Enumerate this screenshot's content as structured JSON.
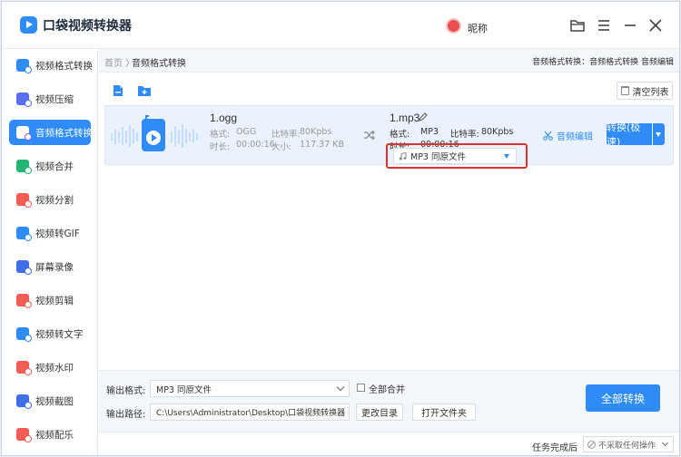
{
  "app": {
    "title": "口袋视频转换器",
    "user_name": "昵称"
  },
  "colors": {
    "accent": "#2f8cf6",
    "highlight": "#e0302e"
  },
  "window_controls": [
    "folder-icon",
    "menu-icon",
    "minimize-icon",
    "close-icon"
  ],
  "sidebar": {
    "items": [
      {
        "label": "视频格式转换",
        "icon": "video-format-icon",
        "color": "#2f8cf6",
        "active": false
      },
      {
        "label": "视频压缩",
        "icon": "video-compress-icon",
        "color": "#5b6ef0",
        "active": false
      },
      {
        "label": "音频格式转换",
        "icon": "audio-format-icon",
        "color": "#8b5cf6",
        "active": true
      },
      {
        "label": "视频合并",
        "icon": "video-merge-icon",
        "color": "#22b573",
        "active": false
      },
      {
        "label": "视频分割",
        "icon": "video-split-icon",
        "color": "#f25c54",
        "active": false
      },
      {
        "label": "视频转GIF",
        "icon": "video-gif-icon",
        "color": "#2f8cf6",
        "active": false
      },
      {
        "label": "屏幕录像",
        "icon": "screen-record-icon",
        "color": "#3f6ee8",
        "active": false
      },
      {
        "label": "视频剪辑",
        "icon": "video-edit-icon",
        "color": "#f25c54",
        "active": false
      },
      {
        "label": "视频转文字",
        "icon": "video-text-icon",
        "color": "#2f8cf6",
        "active": false
      },
      {
        "label": "视频水印",
        "icon": "video-watermark-icon",
        "color": "#f25c54",
        "active": false
      },
      {
        "label": "视频截图",
        "icon": "video-screenshot-icon",
        "color": "#3f6ee8",
        "active": false
      },
      {
        "label": "视频配乐",
        "icon": "video-music-icon",
        "color": "#f25c54",
        "active": false
      }
    ]
  },
  "breadcrumb": {
    "home": "首页",
    "separator": "〉",
    "current": "音频格式转换",
    "right_text": "音频格式转换：音频格式转换 音频编辑"
  },
  "toolbar": {
    "clear_label": "清空列表"
  },
  "file": {
    "source": {
      "name": "1.ogg",
      "format_label": "格式:",
      "format": "OGG",
      "bitrate_label": "比特率:",
      "bitrate": "80Kpbs",
      "duration_label": "时长:",
      "duration": "00:00:16",
      "size_label": "大小:",
      "size": "117.37 KB"
    },
    "target": {
      "name": "1.mp3",
      "format_label": "格式:",
      "format": "MP3",
      "bitrate_label": "比特率:",
      "bitrate": "80Kpbs",
      "duration_label": "时长:",
      "duration": "00:00:16"
    },
    "format_select": "MP3   同原文件",
    "edit_audio_label": "音频编辑",
    "convert_label": "转换(极速)"
  },
  "output": {
    "format_label": "输出格式:",
    "format_value": "MP3   同原文件",
    "merge_label": "全部合并",
    "path_label": "输出路径:",
    "path_value": "C:\\Users\\Administrator\\Desktop\\口袋视频转换器",
    "change_dir_label": "更改目录",
    "open_folder_label": "打开文件夹",
    "convert_all_label": "全部转换"
  },
  "footer": {
    "after_label": "任务完成后",
    "after_value": "不采取任何操作"
  }
}
